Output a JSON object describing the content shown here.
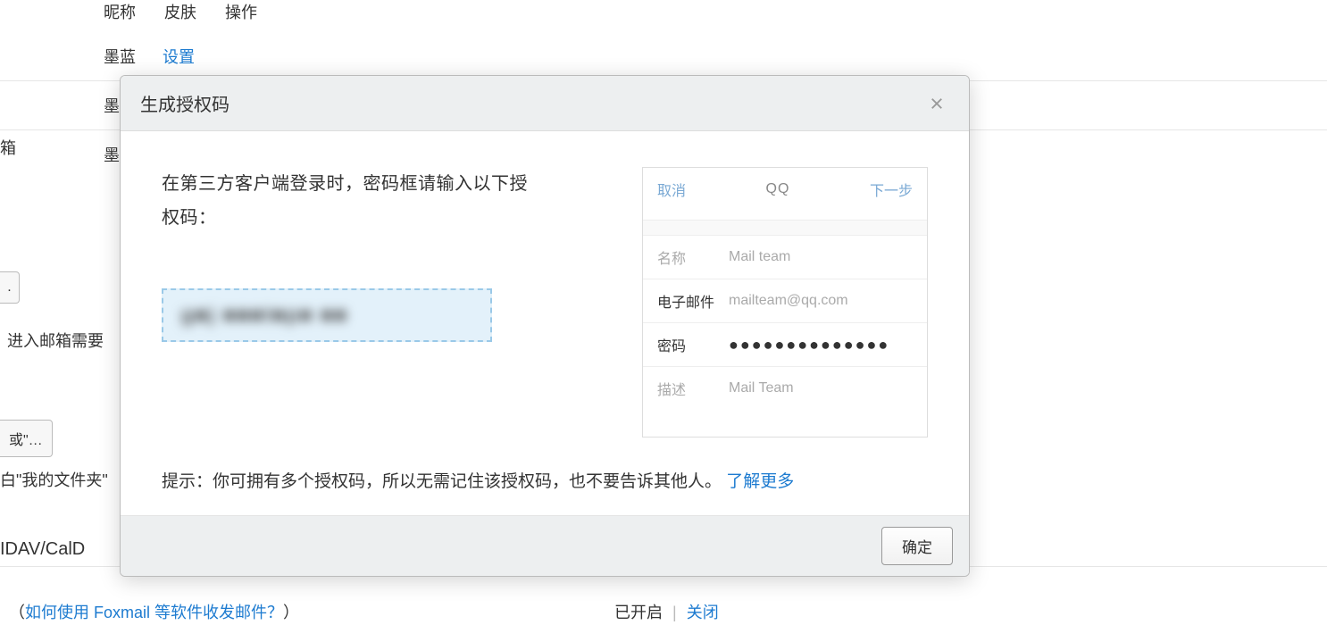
{
  "bg": {
    "header": {
      "col1": "昵称",
      "col2": "皮肤",
      "col3": "操作"
    },
    "row1_skin": "墨蓝",
    "row1_action": "设置",
    "row2_prefix": "墨",
    "row3_prefix": "墨",
    "trunc_box_label": "箱",
    "btn1": ".",
    "enter_text": "进入邮箱需要",
    "btn2": "或\"…",
    "myfolder": "白\"我的文件夹\"",
    "dav_text": "IDAV/CalD",
    "foxmail_prefix": "（",
    "foxmail_link": "如何使用 Foxmail 等软件收发邮件？",
    "foxmail_suffix": "）",
    "status_enabled": "已开启",
    "status_close": "关闭"
  },
  "modal": {
    "title": "生成授权码",
    "instruction": "在第三方客户端登录时，密码框请输入以下授权码：",
    "auth_code_blur": "g■j ■■■t■p■ ■■",
    "phone": {
      "cancel": "取消",
      "title": "QQ",
      "next": "下一步",
      "rows": {
        "name_label": "名称",
        "name_value": "Mail team",
        "email_label": "电子邮件",
        "email_value": "mailteam@qq.com",
        "pwd_label": "密码",
        "pwd_value": "●●●●●●●●●●●●●●",
        "desc_label": "描述",
        "desc_value": "Mail Team"
      }
    },
    "tip_prefix": "提示：你可拥有多个授权码，所以无需记住该授权码，也不要告诉其他人。",
    "tip_link": "了解更多",
    "ok": "确定"
  }
}
